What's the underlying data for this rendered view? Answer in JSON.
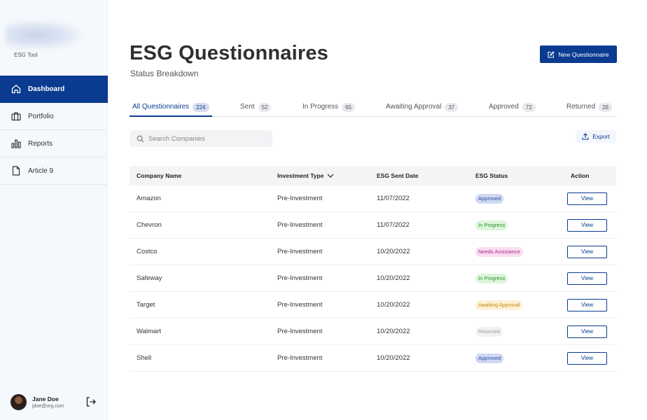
{
  "sidebar": {
    "app_name": "ESG Tool",
    "items": [
      {
        "label": "Dashboard",
        "icon": "home-icon",
        "active": true
      },
      {
        "label": "Portfolio",
        "icon": "briefcase-icon",
        "active": false
      },
      {
        "label": "Reports",
        "icon": "bar-chart-icon",
        "active": false
      },
      {
        "label": "Article 9",
        "icon": "document-icon",
        "active": false
      }
    ],
    "user": {
      "name": "Jane Doe",
      "email": "jdoe@org.com"
    }
  },
  "header": {
    "title": "ESG Questionnaires",
    "subtitle": "Status Breakdown",
    "new_button_label": "New Questionnaire"
  },
  "tabs": [
    {
      "label": "All Questionnaires",
      "count": "224",
      "active": true
    },
    {
      "label": "Sent",
      "count": "52",
      "active": false
    },
    {
      "label": "In Progress",
      "count": "65",
      "active": false
    },
    {
      "label": "Awaiting Approval",
      "count": "37",
      "active": false
    },
    {
      "label": "Approved",
      "count": "72",
      "active": false
    },
    {
      "label": "Returned",
      "count": "28",
      "active": false
    }
  ],
  "search": {
    "placeholder": "Search Companies"
  },
  "export_label": "Export",
  "table": {
    "columns": [
      "Company Name",
      "Investment Type",
      "ESG Sent Date",
      "ESG Status",
      "Action"
    ],
    "rows": [
      {
        "company": "Amazon",
        "type": "Pre-Investment",
        "date": "11/07/2022",
        "status": "Approved",
        "action": "View"
      },
      {
        "company": "Chevron",
        "type": "Pre-Investment",
        "date": "11/07/2022",
        "status": "In Progress",
        "action": "View"
      },
      {
        "company": "Costco",
        "type": "Pre-Investment",
        "date": "10/20/2022",
        "status": "Needs Assistance",
        "action": "View"
      },
      {
        "company": "Safeway",
        "type": "Pre-Investment",
        "date": "10/20/2022",
        "status": "In Progress",
        "action": "View"
      },
      {
        "company": "Target",
        "type": "Pre-Investment",
        "date": "10/20/2022",
        "status": "Awaiting Approval",
        "action": "View"
      },
      {
        "company": "Walmart",
        "type": "Pre-Investment",
        "date": "10/20/2022",
        "status": "Returned",
        "action": "View"
      },
      {
        "company": "Shell",
        "type": "Pre-Investment",
        "date": "10/20/2022",
        "status": "Approved",
        "action": "View"
      }
    ]
  },
  "colors": {
    "brand": "#0b3b91",
    "approved": "#cfd8f3",
    "in_progress": "#dcf6dc",
    "needs_assistance": "#fadcf0",
    "awaiting_approval": "#fdf1d4",
    "returned": "#f1f2f4"
  }
}
